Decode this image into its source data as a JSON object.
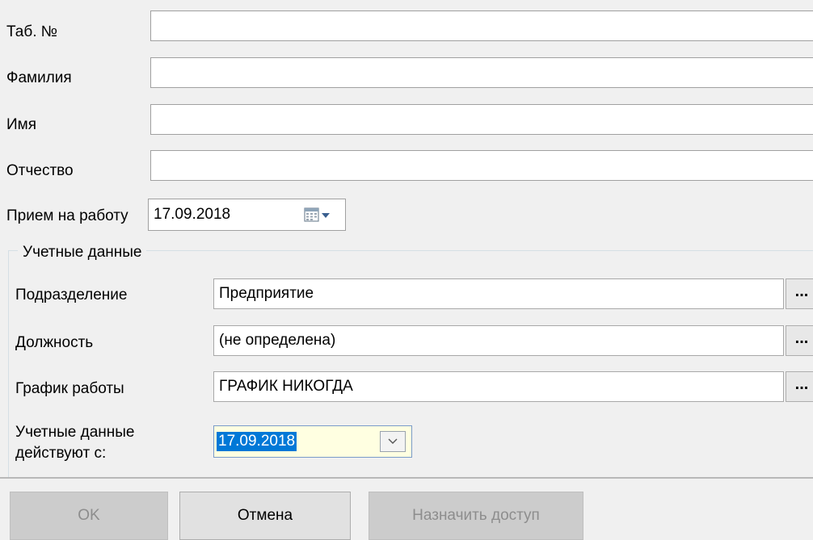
{
  "personal": {
    "tab_no_label": "Таб. №",
    "tab_no_value": "",
    "surname_label": "Фамилия",
    "surname_value": "",
    "name_label": "Имя",
    "name_value": "",
    "patronymic_label": "Отчество",
    "patronymic_value": "",
    "hire_label": "Прием на работу",
    "hire_date": "17.09.2018"
  },
  "account": {
    "group_title": "Учетные данные",
    "department_label": "Подразделение",
    "department_value": "Предприятие",
    "position_label": "Должность",
    "position_value": "(не определена)",
    "schedule_label": "График работы",
    "schedule_value": "ГРАФИК НИКОГДА",
    "valid_from_label_1": "Учетные данные",
    "valid_from_label_2": "действуют с:",
    "valid_from_value": "17.09.2018",
    "browse_label": "..."
  },
  "buttons": {
    "ok": "OK",
    "cancel": "Отмена",
    "assign_access": "Назначить доступ"
  },
  "colors": {
    "background": "#f0f0f0",
    "selection": "#0078d7",
    "date_edit_bg": "#ffffe1"
  }
}
